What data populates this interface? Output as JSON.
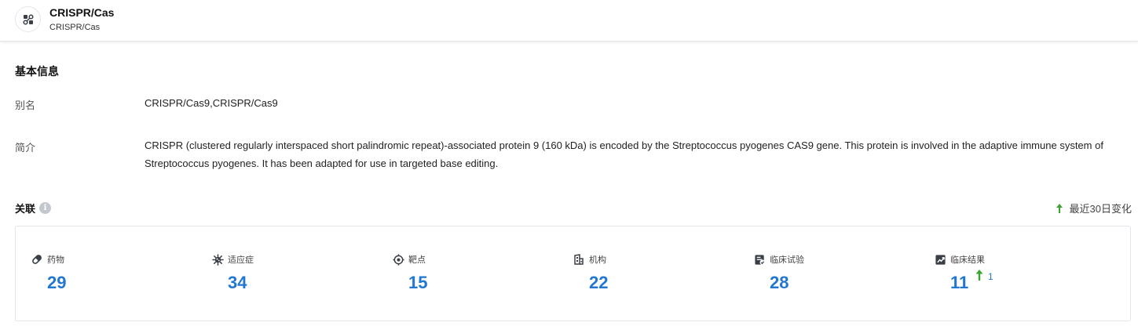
{
  "header": {
    "title": "CRISPR/Cas",
    "subtitle": "CRISPR/Cas",
    "icon": "molecule-icon"
  },
  "basic_info": {
    "section_title": "基本信息",
    "alias_label": "别名",
    "alias_value": "CRISPR/Cas9,CRISPR/Cas9",
    "description_label": "简介",
    "description_value": "CRISPR (clustered regularly interspaced short palindromic repeat)-associated protein 9 (160 kDa) is encoded by the Streptococcus pyogenes CAS9 gene. This protein is involved in the adaptive immune system of Streptococcus pyogenes. It has been adapted for use in targeted base editing."
  },
  "related": {
    "title": "关联",
    "info_icon": "i",
    "recent_change_label": "最近30日变化",
    "accent_color": "#2277d1",
    "increase_color": "#3ba32f",
    "stats": [
      {
        "label": "药物",
        "value": "29",
        "icon": "pill-icon"
      },
      {
        "label": "适应症",
        "value": "34",
        "icon": "virus-icon"
      },
      {
        "label": "靶点",
        "value": "15",
        "icon": "target-icon"
      },
      {
        "label": "机构",
        "value": "22",
        "icon": "building-icon"
      },
      {
        "label": "临床试验",
        "value": "28",
        "icon": "clinical-trial-icon"
      },
      {
        "label": "临床结果",
        "value": "11",
        "icon": "clinical-result-icon",
        "change": "1"
      }
    ]
  }
}
